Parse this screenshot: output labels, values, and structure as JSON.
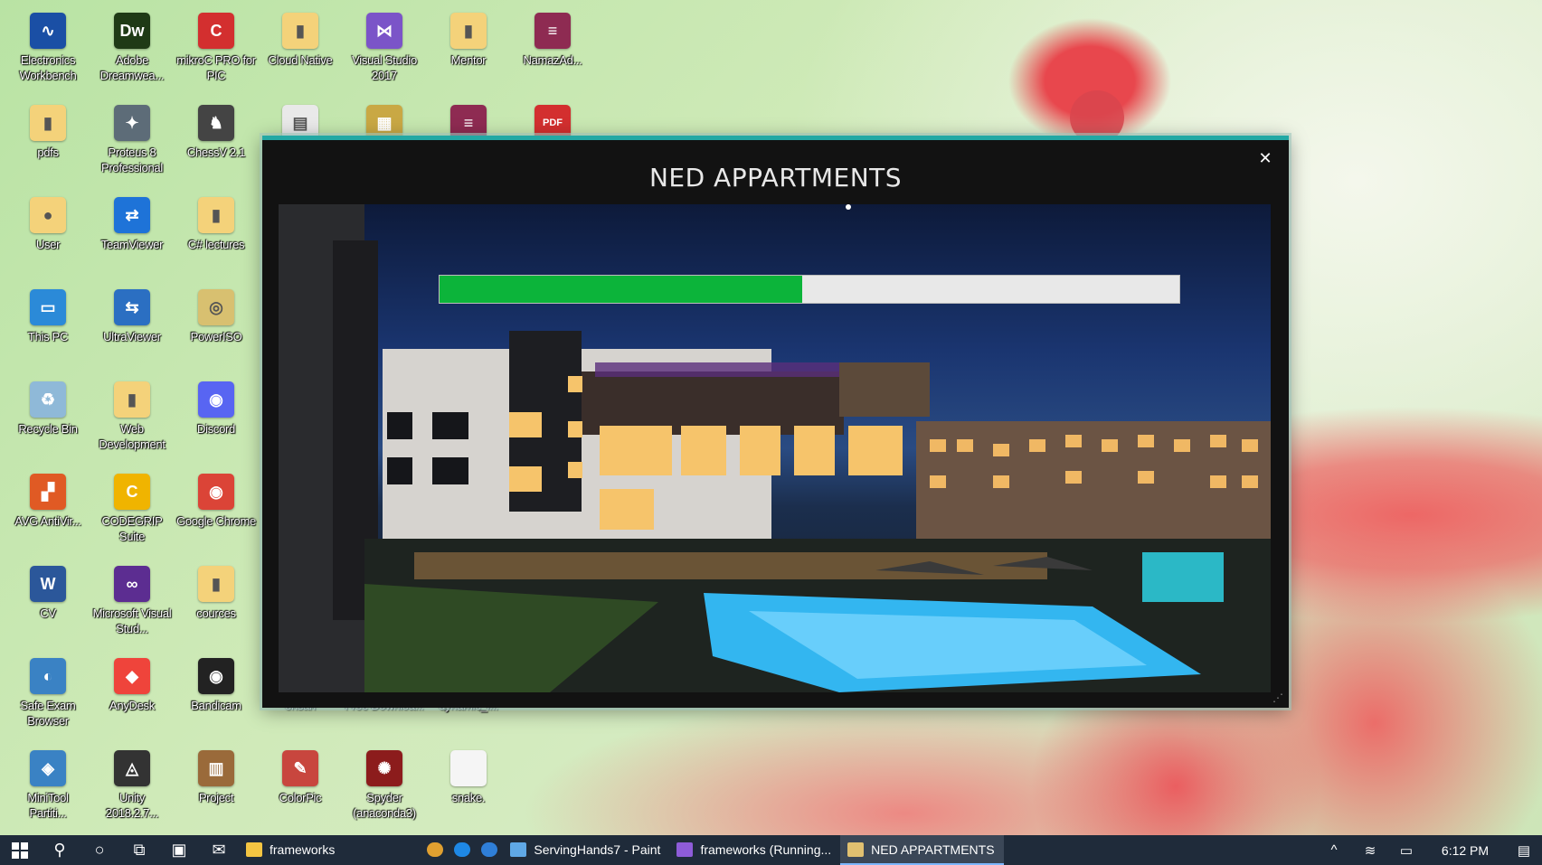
{
  "desktop": {
    "icons": [
      {
        "label": "Electronics Workbench",
        "col": 0,
        "row": 0,
        "color": "#1a4fa5",
        "glyph": "∿"
      },
      {
        "label": "Adobe Dreamwea...",
        "col": 1,
        "row": 0,
        "color": "#1f3a16",
        "glyph": "Dw"
      },
      {
        "label": "mikroC PRO for PIC",
        "col": 2,
        "row": 0,
        "color": "#d32f2f",
        "glyph": "C"
      },
      {
        "label": "Cloud Native",
        "col": 3,
        "row": 0,
        "color": "#f4d27a",
        "glyph": "▮"
      },
      {
        "label": "Visual Studio 2017",
        "col": 4,
        "row": 0,
        "color": "#7b54c8",
        "glyph": "⋈"
      },
      {
        "label": "Mentor",
        "col": 5,
        "row": 0,
        "color": "#f4d27a",
        "glyph": "▮"
      },
      {
        "label": "NamazAd...",
        "col": 6,
        "row": 0,
        "color": "#8e2b52",
        "glyph": "≡"
      },
      {
        "label": "pdfs",
        "col": 0,
        "row": 1,
        "color": "#f4d27a",
        "glyph": "▮"
      },
      {
        "label": "Proteus 8 Professional",
        "col": 1,
        "row": 1,
        "color": "#5d6c78",
        "glyph": "✦"
      },
      {
        "label": "ChessV 2.1",
        "col": 2,
        "row": 1,
        "color": "#444444",
        "glyph": "♞"
      },
      {
        "label": "",
        "col": 3,
        "row": 1,
        "color": "#e9e9e9",
        "glyph": "▤"
      },
      {
        "label": "",
        "col": 4,
        "row": 1,
        "color": "#c9a844",
        "glyph": "▦"
      },
      {
        "label": "",
        "col": 5,
        "row": 1,
        "color": "#8e2b52",
        "glyph": "≡"
      },
      {
        "label": "",
        "col": 6,
        "row": 1,
        "color": "#d32f2f",
        "glyph": "PDF"
      },
      {
        "label": "User",
        "col": 0,
        "row": 2,
        "color": "#f4d27a",
        "glyph": "●"
      },
      {
        "label": "TeamViewer",
        "col": 1,
        "row": 2,
        "color": "#1e73d8",
        "glyph": "⇄"
      },
      {
        "label": "C# lectures",
        "col": 2,
        "row": 2,
        "color": "#f4d27a",
        "glyph": "▮"
      },
      {
        "label": "This PC",
        "col": 0,
        "row": 3,
        "color": "#2b8ad8",
        "glyph": "▭"
      },
      {
        "label": "UltraViewer",
        "col": 1,
        "row": 3,
        "color": "#2b6fc2",
        "glyph": "⇆"
      },
      {
        "label": "PowerISO",
        "col": 2,
        "row": 3,
        "color": "#d8c070",
        "glyph": "◎"
      },
      {
        "label": "Recycle Bin",
        "col": 0,
        "row": 4,
        "color": "#8fb9d8",
        "glyph": "♻"
      },
      {
        "label": "Web Development",
        "col": 1,
        "row": 4,
        "color": "#f4d27a",
        "glyph": "▮"
      },
      {
        "label": "Discord",
        "col": 2,
        "row": 4,
        "color": "#5865f2",
        "glyph": "◉"
      },
      {
        "label": "AVG AntiVir...",
        "col": 0,
        "row": 5,
        "color": "#e05a24",
        "glyph": "▞"
      },
      {
        "label": "CODEGRIP Suite",
        "col": 1,
        "row": 5,
        "color": "#f0b400",
        "glyph": "C"
      },
      {
        "label": "Google Chrome",
        "col": 2,
        "row": 5,
        "color": "#db4437",
        "glyph": "◉"
      },
      {
        "label": "CV",
        "col": 0,
        "row": 6,
        "color": "#2b579a",
        "glyph": "W"
      },
      {
        "label": "Microsoft Visual Stud...",
        "col": 1,
        "row": 6,
        "color": "#5c2d91",
        "glyph": "∞"
      },
      {
        "label": "cources",
        "col": 2,
        "row": 6,
        "color": "#f4d27a",
        "glyph": "▮"
      },
      {
        "label": "Safe Exam Browser",
        "col": 0,
        "row": 7,
        "color": "#3a82c4",
        "glyph": "◐"
      },
      {
        "label": "AnyDesk",
        "col": 1,
        "row": 7,
        "color": "#ef443b",
        "glyph": "◆"
      },
      {
        "label": "Bandicam",
        "col": 2,
        "row": 7,
        "color": "#222222",
        "glyph": "◉"
      },
      {
        "label": "ehsan",
        "col": 3,
        "row": 7,
        "color": "#c9c9c9",
        "glyph": "▮"
      },
      {
        "label": "Free Downloa...",
        "col": 4,
        "row": 7,
        "color": "#c9c9c9",
        "glyph": "▮"
      },
      {
        "label": "dynamic_l...",
        "col": 5,
        "row": 7,
        "color": "#c9c9c9",
        "glyph": "▮"
      },
      {
        "label": "MiniTool Partiti...",
        "col": 0,
        "row": 8,
        "color": "#3a82c4",
        "glyph": "◈"
      },
      {
        "label": "Unity 2018.2.7...",
        "col": 1,
        "row": 8,
        "color": "#333333",
        "glyph": "◬"
      },
      {
        "label": "Project",
        "col": 2,
        "row": 8,
        "color": "#9a6a3a",
        "glyph": "▥"
      },
      {
        "label": "ColorPic",
        "col": 3,
        "row": 8,
        "color": "#c8463e",
        "glyph": "✎"
      },
      {
        "label": "Spyder (anaconda3)",
        "col": 4,
        "row": 8,
        "color": "#8c1c1c",
        "glyph": "✺"
      },
      {
        "label": "snake.",
        "col": 5,
        "row": 8,
        "color": "#f5f5f5",
        "glyph": ""
      }
    ]
  },
  "dialog": {
    "title": "NED APPARTMENTS",
    "close_label": "✕",
    "progress_fraction": 0.49,
    "accent": "#22a8a4",
    "progress_color": "#0cb43a"
  },
  "taskbar": {
    "search_icon": "⚲",
    "cortana_icon": "○",
    "taskview_icon": "⧉",
    "store_icon": "▣",
    "mail_icon": "✉",
    "tasks": [
      {
        "label": "frameworks",
        "color": "#f4c542",
        "active": false
      },
      {
        "label": "",
        "color": "#e0a030",
        "active": false,
        "icon_only": true
      },
      {
        "label": "",
        "color": "#1e88e5",
        "active": false,
        "icon_only": true
      },
      {
        "label": "",
        "color": "#2f7fd8",
        "active": false,
        "icon_only": true
      },
      {
        "label": "ServingHands7 - Paint",
        "color": "#5fa8e6",
        "active": false
      },
      {
        "label": "frameworks (Running...",
        "color": "#8e5cd8",
        "active": false
      },
      {
        "label": "NED APPARTMENTS",
        "color": "#e0c070",
        "active": true
      }
    ],
    "tray": {
      "chevron": "^",
      "wifi": "≋",
      "battery": "▭",
      "time": "6:12 PM",
      "notification": "▤"
    }
  }
}
